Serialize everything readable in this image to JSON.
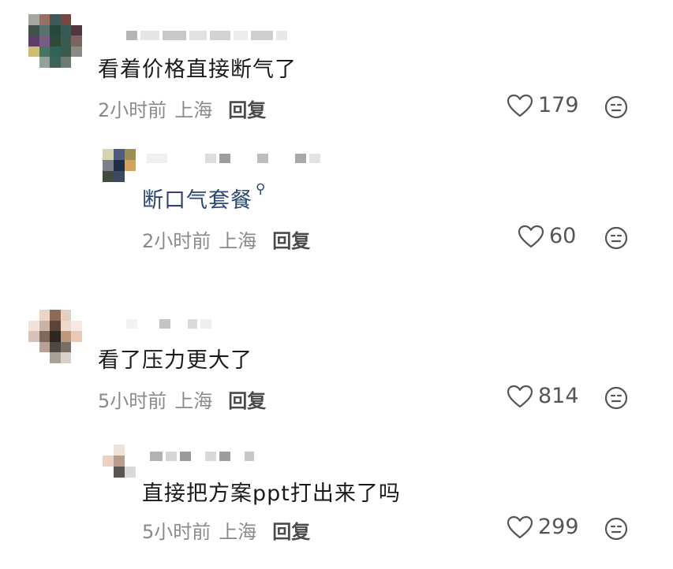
{
  "colors": {
    "reply_link": "#2c4770",
    "meta_gray": "#8a8a8a",
    "icon_gray": "#555555"
  },
  "comments": [
    {
      "text": "看着价格直接断气了",
      "time": "2小时前",
      "location": "上海",
      "reply_label": "回复",
      "likes": "179"
    },
    {
      "text": "断口气套餐",
      "search_icon": "search-hint-icon",
      "time": "2小时前",
      "location": "上海",
      "reply_label": "回复",
      "likes": "60"
    },
    {
      "text": "看了压力更大了",
      "time": "5小时前",
      "location": "上海",
      "reply_label": "回复",
      "likes": "814"
    },
    {
      "text": "直接把方案ppt打出来了吗",
      "time": "5小时前",
      "location": "上海",
      "reply_label": "回复",
      "likes": "299"
    }
  ],
  "icons": {
    "like": "heart-outline-icon",
    "dislike": "face-neutral-icon"
  }
}
